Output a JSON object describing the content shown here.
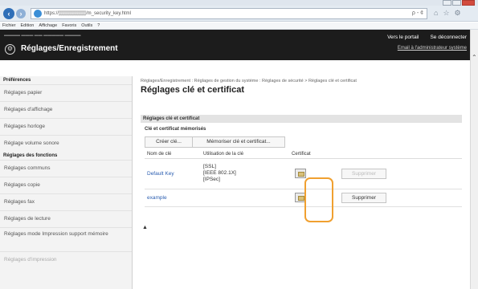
{
  "browser": {
    "url": "https://▒▒▒▒▒▒▒▒/m_security_key.html",
    "search_controls": "ρ - ¢",
    "menu": [
      "Fichier",
      "Edition",
      "Affichage",
      "Favoris",
      "Outils",
      "?"
    ]
  },
  "header": {
    "title": "Réglages/Enregistrement",
    "portal_link": "Vers le portail",
    "logout_link": "Se déconnecter",
    "email_link": "Email à l'administrateur système"
  },
  "sidebar": {
    "sections": [
      {
        "title": "Préférences",
        "items": [
          "Réglages papier",
          "Réglages d'affichage",
          "Réglages horloge",
          "Réglage volume sonore"
        ]
      },
      {
        "title": "Réglages des fonctions",
        "items": [
          "Réglages communs",
          "Réglages copie",
          "Réglages fax",
          "Réglages de lecture",
          "Réglages mode Impression support mémoire",
          "Réglages d'impression"
        ]
      }
    ]
  },
  "main": {
    "breadcrumb": "Réglages/Enregistrement : Réglages de gestion du système : Réglages de sécurité > Réglages clé et certificat",
    "title": "Réglages clé et certificat",
    "section_title": "Réglages clé et certificat",
    "subsection_title": "Clé et certificat mémorisés",
    "buttons": {
      "create": "Créer clé...",
      "register": "Mémoriser clé et certificat..."
    },
    "table": {
      "headers": [
        "Nom de clé",
        "Utilisation de la clé",
        "Certificat",
        ""
      ],
      "rows": [
        {
          "name": "Default Key",
          "usage": [
            "[SSL]",
            "[IEEE 802.1X]",
            "[IPSec]"
          ],
          "delete_label": "Supprimer",
          "delete_enabled": false
        },
        {
          "name": "example",
          "usage": [],
          "delete_label": "Supprimer",
          "delete_enabled": true
        }
      ]
    },
    "back_to_top": "▲"
  },
  "colors": {
    "header_bg": "#1c1c1c",
    "highlight": "#f0a030",
    "link": "#2a5db0"
  }
}
